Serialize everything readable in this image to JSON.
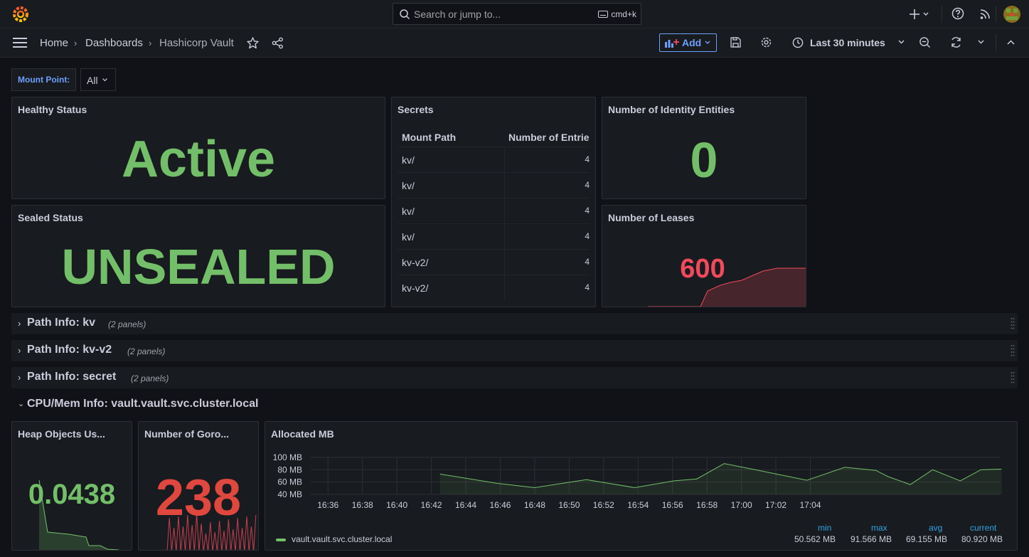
{
  "topbar": {
    "search_placeholder": "Search or jump to...",
    "search_shortcut": "cmd+k"
  },
  "breadcrumb": {
    "home": "Home",
    "dashboards": "Dashboards",
    "current": "Hashicorp Vault"
  },
  "toolbar": {
    "add_label": "Add",
    "time_range": "Last 30 minutes"
  },
  "variables": {
    "mount_point_label": "Mount Point:",
    "mount_point_value": "All"
  },
  "panels": {
    "healthy": {
      "title": "Healthy Status",
      "value": "Active"
    },
    "sealed": {
      "title": "Sealed Status",
      "value": "UNSEALED"
    },
    "secrets": {
      "title": "Secrets",
      "columns": [
        "Mount Path",
        "Number of Entrie"
      ],
      "rows": [
        {
          "path": "kv/",
          "count": "4"
        },
        {
          "path": "kv/",
          "count": "4"
        },
        {
          "path": "kv/",
          "count": "4"
        },
        {
          "path": "kv/",
          "count": "4"
        },
        {
          "path": "kv-v2/",
          "count": "4"
        },
        {
          "path": "kv-v2/",
          "count": "4"
        }
      ]
    },
    "identity": {
      "title": "Number of Identity Entities",
      "value": "0"
    },
    "leases": {
      "title": "Number of Leases",
      "value": "600"
    },
    "heap": {
      "title": "Heap Objects Us...",
      "value": "0.0438"
    },
    "goroutines": {
      "title": "Number of Goro...",
      "value": "238"
    },
    "allocated": {
      "title": "Allocated MB"
    }
  },
  "rows": [
    {
      "title": "Path Info: kv",
      "count": "(2 panels)"
    },
    {
      "title": "Path Info: kv-v2",
      "count": "(2 panels)"
    },
    {
      "title": "Path Info: secret",
      "count": "(2 panels)"
    }
  ],
  "open_row": {
    "title": "CPU/Mem Info: vault.vault.svc.cluster.local"
  },
  "legend": {
    "series": "vault.vault.svc.cluster.local",
    "headers": {
      "min": "min",
      "max": "max",
      "avg": "avg",
      "current": "current"
    },
    "values": {
      "min": "50.562 MB",
      "max": "91.566 MB",
      "avg": "69.155 MB",
      "current": "80.920 MB"
    }
  },
  "colors": {
    "green": "#73bf69",
    "red": "#f2495c",
    "blue": "#6e9fff"
  },
  "chart_data": {
    "type": "line",
    "title": "Allocated MB",
    "xlabel": "",
    "ylabel": "",
    "y_ticks": [
      "100 MB",
      "80 MB",
      "60 MB",
      "40 MB"
    ],
    "x_ticks": [
      "16:36",
      "16:38",
      "16:40",
      "16:42",
      "16:44",
      "16:46",
      "16:48",
      "16:50",
      "16:52",
      "16:54",
      "16:56",
      "16:58",
      "17:00",
      "17:02",
      "17:04"
    ],
    "ylim": [
      40,
      100
    ],
    "xlim_minutes": [
      -1,
      33
    ],
    "series": [
      {
        "name": "vault.vault.svc.cluster.local",
        "x_minutes": [
          6.5,
          9.8,
          12.0,
          15.0,
          17.8,
          20.1,
          21.4,
          23.0,
          25.0,
          27.8,
          30.0,
          31.8,
          32.5,
          33.8,
          35.1,
          36.7,
          37.9,
          39.1
        ],
        "values": [
          73,
          58,
          51,
          64,
          51,
          62,
          65,
          90,
          79,
          63,
          84,
          79,
          69,
          56,
          80,
          62,
          80,
          81
        ]
      }
    ]
  }
}
